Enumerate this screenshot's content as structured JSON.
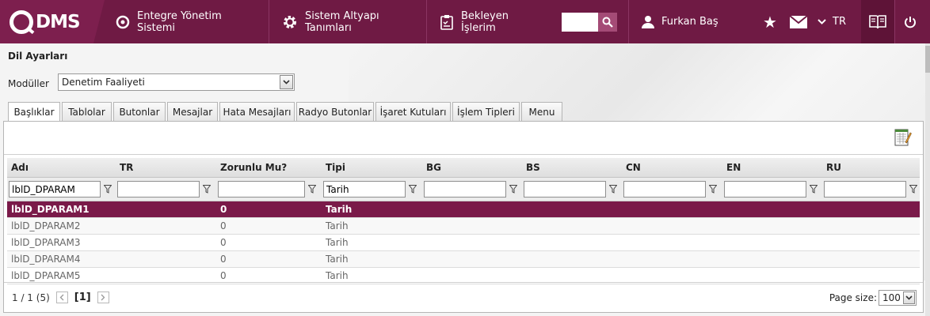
{
  "app": {
    "logo_text": "DMS",
    "nav": [
      {
        "label": "Entegre Yönetim Sistemi",
        "icon": "q-circle-icon"
      },
      {
        "label": "Sistem Altyapı Tanımları",
        "icon": "gear-icon"
      },
      {
        "label": "Bekleyen İşlerim",
        "icon": "clipboard-icon"
      }
    ],
    "search_placeholder": "",
    "user_name": "Furkan Baş",
    "language": "TR",
    "colors": {
      "brand": "#6f1a44",
      "selected_row": "#7a1a49"
    }
  },
  "page": {
    "title": "Dil Ayarları",
    "module_label": "Modüller",
    "module_value": "Denetim Faaliyeti"
  },
  "tabs": [
    {
      "label": "Başlıklar",
      "active": true
    },
    {
      "label": "Tablolar"
    },
    {
      "label": "Butonlar"
    },
    {
      "label": "Mesajlar"
    },
    {
      "label": "Hata Mesajları"
    },
    {
      "label": "Radyo Butonlar"
    },
    {
      "label": "İşaret Kutuları"
    },
    {
      "label": "İşlem Tipleri"
    },
    {
      "label": "Menu"
    }
  ],
  "grid": {
    "columns": [
      "Adı",
      "TR",
      "Zorunlu Mu?",
      "Tipi",
      "BG",
      "BS",
      "CN",
      "EN",
      "RU"
    ],
    "filters": [
      "lblD_DPARAM",
      "",
      "",
      "Tarih",
      "",
      "",
      "",
      "",
      ""
    ],
    "rows": [
      [
        "lblD_DPARAM1",
        "",
        "0",
        "Tarih",
        "",
        "",
        "",
        "",
        ""
      ],
      [
        "lblD_DPARAM2",
        "",
        "0",
        "Tarih",
        "",
        "",
        "",
        "",
        ""
      ],
      [
        "lblD_DPARAM3",
        "",
        "0",
        "Tarih",
        "",
        "",
        "",
        "",
        ""
      ],
      [
        "lblD_DPARAM4",
        "",
        "0",
        "Tarih",
        "",
        "",
        "",
        "",
        ""
      ],
      [
        "lblD_DPARAM5",
        "",
        "0",
        "Tarih",
        "",
        "",
        "",
        "",
        ""
      ]
    ]
  },
  "pager": {
    "info": "1 / 1 (5)",
    "current": "[1]",
    "page_size_label": "Page size:",
    "page_size": "100"
  }
}
